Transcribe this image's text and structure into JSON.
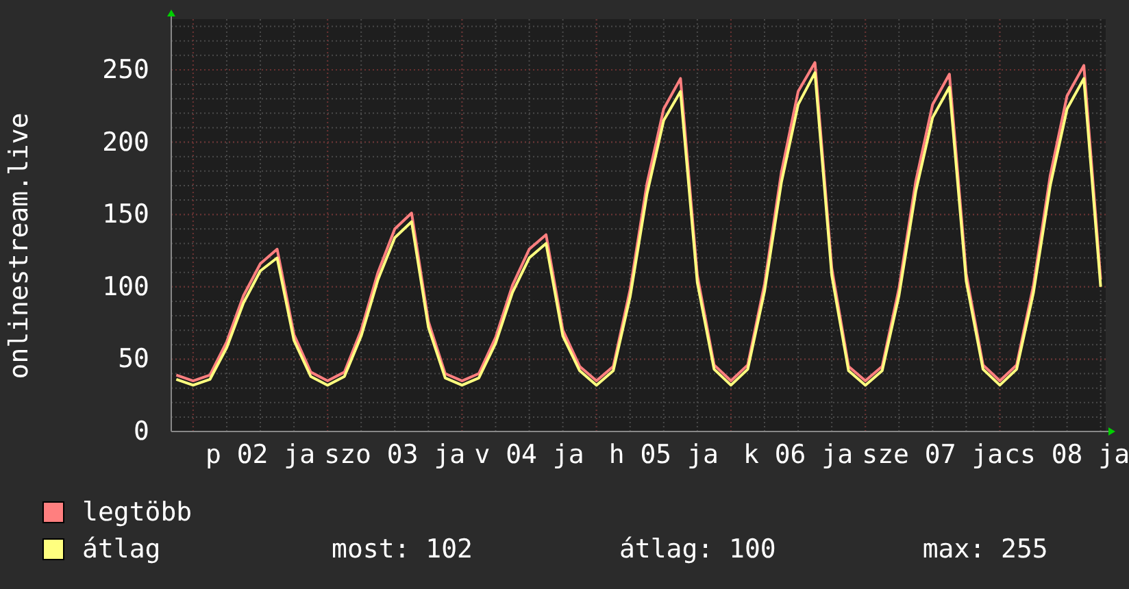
{
  "chart": {
    "chart_data": {
      "type": "line",
      "grid": true,
      "ylabel": "onlinestream.live",
      "ylim": [
        0,
        285
      ],
      "yticks": [
        0,
        50,
        100,
        150,
        200,
        250
      ],
      "categories": [
        null,
        null,
        null,
        null,
        null,
        "p 02 ja",
        null,
        null,
        null,
        null,
        null,
        null,
        null,
        "szo 03 ja",
        null,
        null,
        null,
        null,
        null,
        null,
        null,
        "v 04 ja",
        null,
        null,
        null,
        null,
        null,
        null,
        null,
        "h 05 ja",
        null,
        null,
        null,
        null,
        null,
        null,
        null,
        "k 06 ja",
        null,
        null,
        null,
        null,
        null,
        null,
        null,
        "sze 07 ja",
        null,
        null,
        null,
        null,
        null,
        null,
        null,
        "cs 08 ja",
        null,
        null
      ],
      "series": [
        {
          "name": "legtöbb",
          "color": "#ff7f7f",
          "values": [
            39,
            35,
            39,
            62,
            94,
            116,
            126,
            67,
            41,
            35,
            41,
            70,
            110,
            140,
            151,
            76,
            40,
            35,
            40,
            65,
            101,
            126,
            136,
            70,
            45,
            35,
            45,
            98,
            171,
            223,
            244,
            108,
            46,
            35,
            46,
            102,
            179,
            235,
            255,
            113,
            45,
            35,
            45,
            99,
            173,
            226,
            247,
            109,
            46,
            35,
            46,
            101,
            177,
            232,
            253,
            105
          ]
        },
        {
          "name": "átlag",
          "color": "#ffff7f",
          "values": [
            36,
            32,
            36,
            58,
            89,
            111,
            120,
            63,
            38,
            32,
            38,
            66,
            105,
            134,
            145,
            72,
            37,
            32,
            37,
            61,
            96,
            120,
            130,
            66,
            42,
            32,
            42,
            93,
            164,
            215,
            235,
            103,
            43,
            32,
            43,
            97,
            172,
            226,
            248,
            108,
            42,
            32,
            42,
            94,
            166,
            217,
            238,
            104,
            43,
            32,
            43,
            96,
            170,
            223,
            244,
            100
          ]
        }
      ]
    }
  },
  "stats": [
    "most: 102",
    "átlag: 100",
    "max: 255"
  ]
}
